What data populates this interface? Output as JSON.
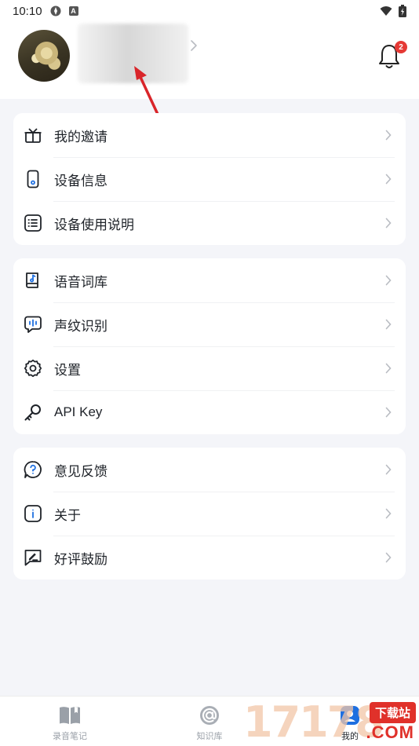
{
  "status_bar": {
    "time": "10:10",
    "b_badge": "A"
  },
  "header": {
    "notification_count": "2"
  },
  "groups": [
    {
      "items": [
        {
          "label": "我的邀请",
          "icon": "gift-icon"
        },
        {
          "label": "设备信息",
          "icon": "phone-icon"
        },
        {
          "label": "设备使用说明",
          "icon": "list-icon"
        }
      ]
    },
    {
      "items": [
        {
          "label": "语音词库",
          "icon": "music-book-icon"
        },
        {
          "label": "声纹识别",
          "icon": "voiceprint-icon"
        },
        {
          "label": "设置",
          "icon": "gear-icon"
        },
        {
          "label": "API Key",
          "icon": "key-icon"
        }
      ]
    },
    {
      "items": [
        {
          "label": "意见反馈",
          "icon": "question-icon"
        },
        {
          "label": "关于",
          "icon": "info-icon"
        },
        {
          "label": "好评鼓励",
          "icon": "rate-icon"
        }
      ]
    }
  ],
  "tabbar": {
    "tabs": [
      {
        "label": "录音笔记",
        "icon": "book-icon"
      },
      {
        "label": "知识库",
        "icon": "at-icon"
      },
      {
        "label": "我的",
        "icon": "profile-icon",
        "active": true
      }
    ]
  },
  "watermark": {
    "digits": "17178",
    "tag": "下载站",
    "com": ".COM"
  },
  "colors": {
    "accent": "#1e6fe0",
    "badge": "#e53935",
    "arrow": "#e0312a",
    "background": "#f4f5f9"
  }
}
